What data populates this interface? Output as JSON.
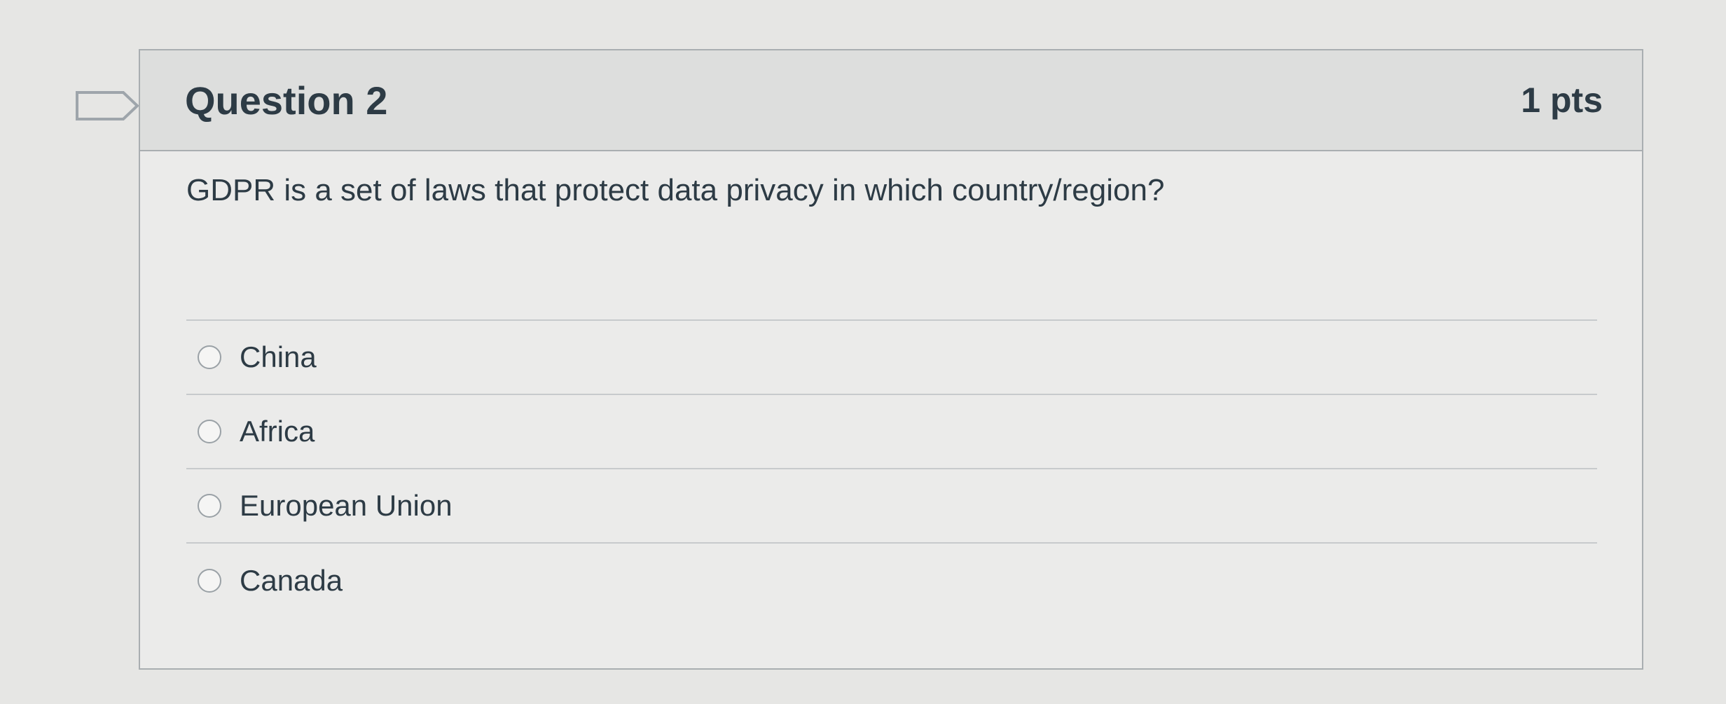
{
  "question": {
    "title": "Question 2",
    "points": "1 pts",
    "text": "GDPR is a set of laws that protect data privacy in which country/region?",
    "answers": [
      {
        "label": "China",
        "selected": false
      },
      {
        "label": "Africa",
        "selected": false
      },
      {
        "label": "European Union",
        "selected": false
      },
      {
        "label": "Canada",
        "selected": false
      }
    ]
  },
  "icons": {
    "flag": "flag-question-icon"
  }
}
